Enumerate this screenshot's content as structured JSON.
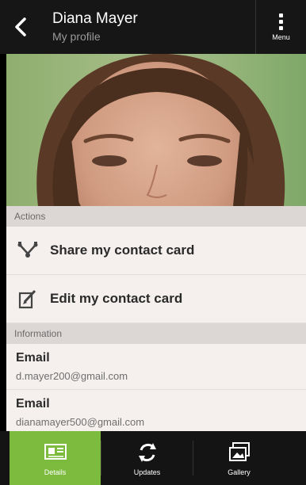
{
  "header": {
    "back_icon": "back-chevron-icon",
    "title": "Diana Mayer",
    "subtitle": "My profile",
    "menu_label": "Menu",
    "menu_icon": "overflow-menu-icon"
  },
  "photo": {
    "subject": "profile-photo"
  },
  "actions": {
    "section_title": "Actions",
    "items": [
      {
        "label": "Share my contact card",
        "icon": "share-icon"
      },
      {
        "label": "Edit my contact card",
        "icon": "edit-icon"
      }
    ]
  },
  "information": {
    "section_title": "Information",
    "items": [
      {
        "label": "Email",
        "value": "d.mayer200@gmail.com"
      },
      {
        "label": "Email",
        "value": "dianamayer500@gmail.com"
      }
    ]
  },
  "bottom_nav": {
    "items": [
      {
        "label": "Details",
        "icon": "details-card-icon",
        "active": true
      },
      {
        "label": "Updates",
        "icon": "refresh-icon",
        "active": false
      },
      {
        "label": "Gallery",
        "icon": "gallery-icon",
        "active": false
      }
    ],
    "active_color": "#7dbb3e"
  }
}
